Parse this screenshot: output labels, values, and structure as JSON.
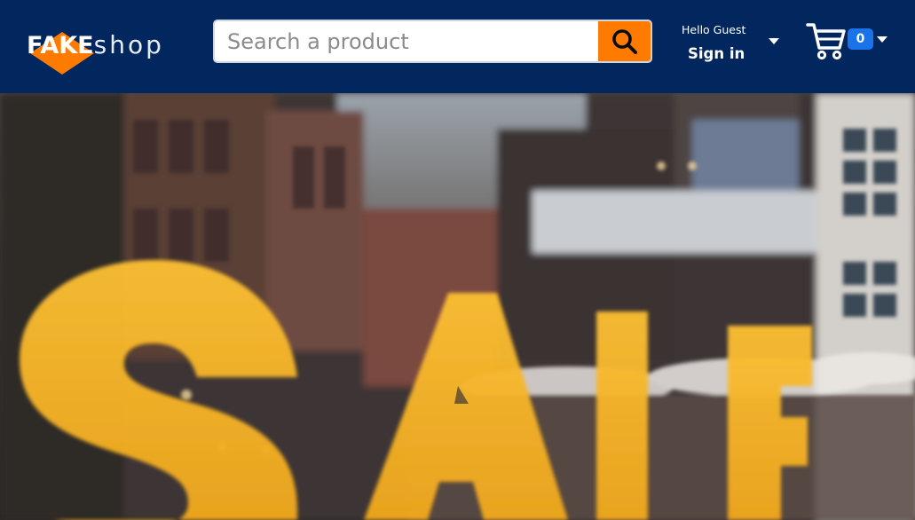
{
  "header": {
    "logo": {
      "word1": "FAKE",
      "word2": "shop",
      "accent_color": "#ff7b00"
    },
    "search": {
      "placeholder": "Search a product",
      "value": "",
      "button_icon": "search-icon"
    },
    "account": {
      "greeting": "Hello Guest",
      "action": "Sign in",
      "icon": "caret-down-icon"
    },
    "cart": {
      "icon": "cart-icon",
      "count": "0"
    },
    "background_color": "#02275e"
  },
  "hero": {
    "image_subject": "storefront window",
    "sign_text": "SALE",
    "sign_color": "#f5b52a"
  }
}
